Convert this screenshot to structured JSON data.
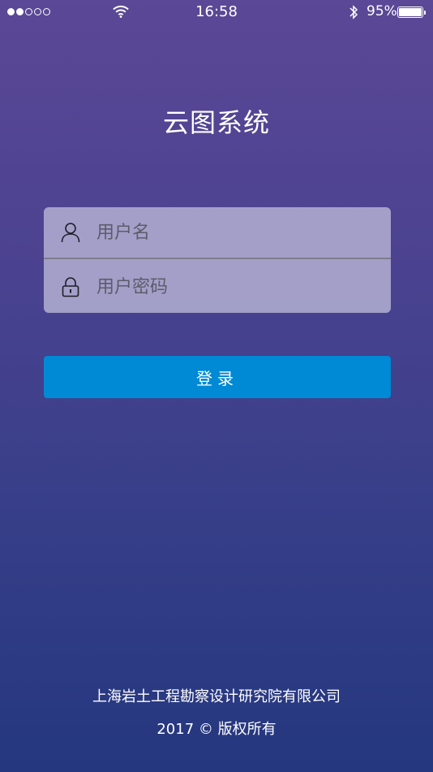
{
  "status_bar": {
    "time": "16:58",
    "battery_percent": "95%",
    "signal_strength": 2,
    "signal_dots": 5,
    "icons": [
      "signal-dots",
      "wifi-icon",
      "bluetooth-icon",
      "battery-icon"
    ]
  },
  "app": {
    "title": "云图系统"
  },
  "form": {
    "username_placeholder": "用户名",
    "username_value": "",
    "password_placeholder": "用户密码",
    "password_value": "",
    "username_icon": "user-icon",
    "password_icon": "lock-icon"
  },
  "login_button": {
    "label": "登录",
    "color": "#0089d4"
  },
  "footer": {
    "company": "上海岩土工程勘察设计研究院有限公司",
    "copyright": "2017 © 版权所有"
  },
  "colors": {
    "background_top": "#5b4896",
    "background_bottom": "#24377f",
    "accent": "#0089d4"
  }
}
